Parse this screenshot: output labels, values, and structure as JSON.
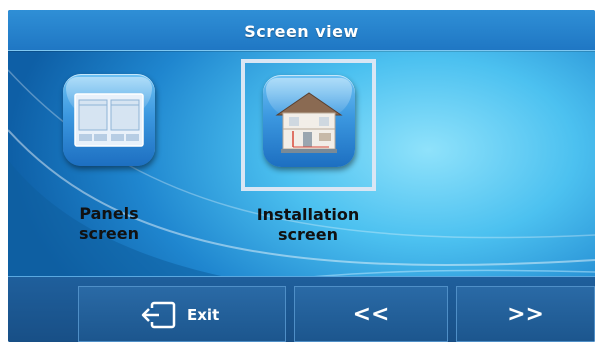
{
  "header": {
    "title": "Screen view"
  },
  "views": [
    {
      "label": "Panels\nscreen",
      "icon": "panels-screen-icon",
      "selected": false
    },
    {
      "label": "Installation\nscreen",
      "icon": "house-installation-icon",
      "selected": true
    }
  ],
  "footer": {
    "exit_label": "Exit",
    "exit_icon": "exit-door-icon",
    "prev_label": "<<",
    "next_label": ">>"
  },
  "colors": {
    "background": "#4cc1f0",
    "header": "#1f77c4",
    "footer": "#184f86",
    "selection_frame": "#d9e6f4"
  }
}
